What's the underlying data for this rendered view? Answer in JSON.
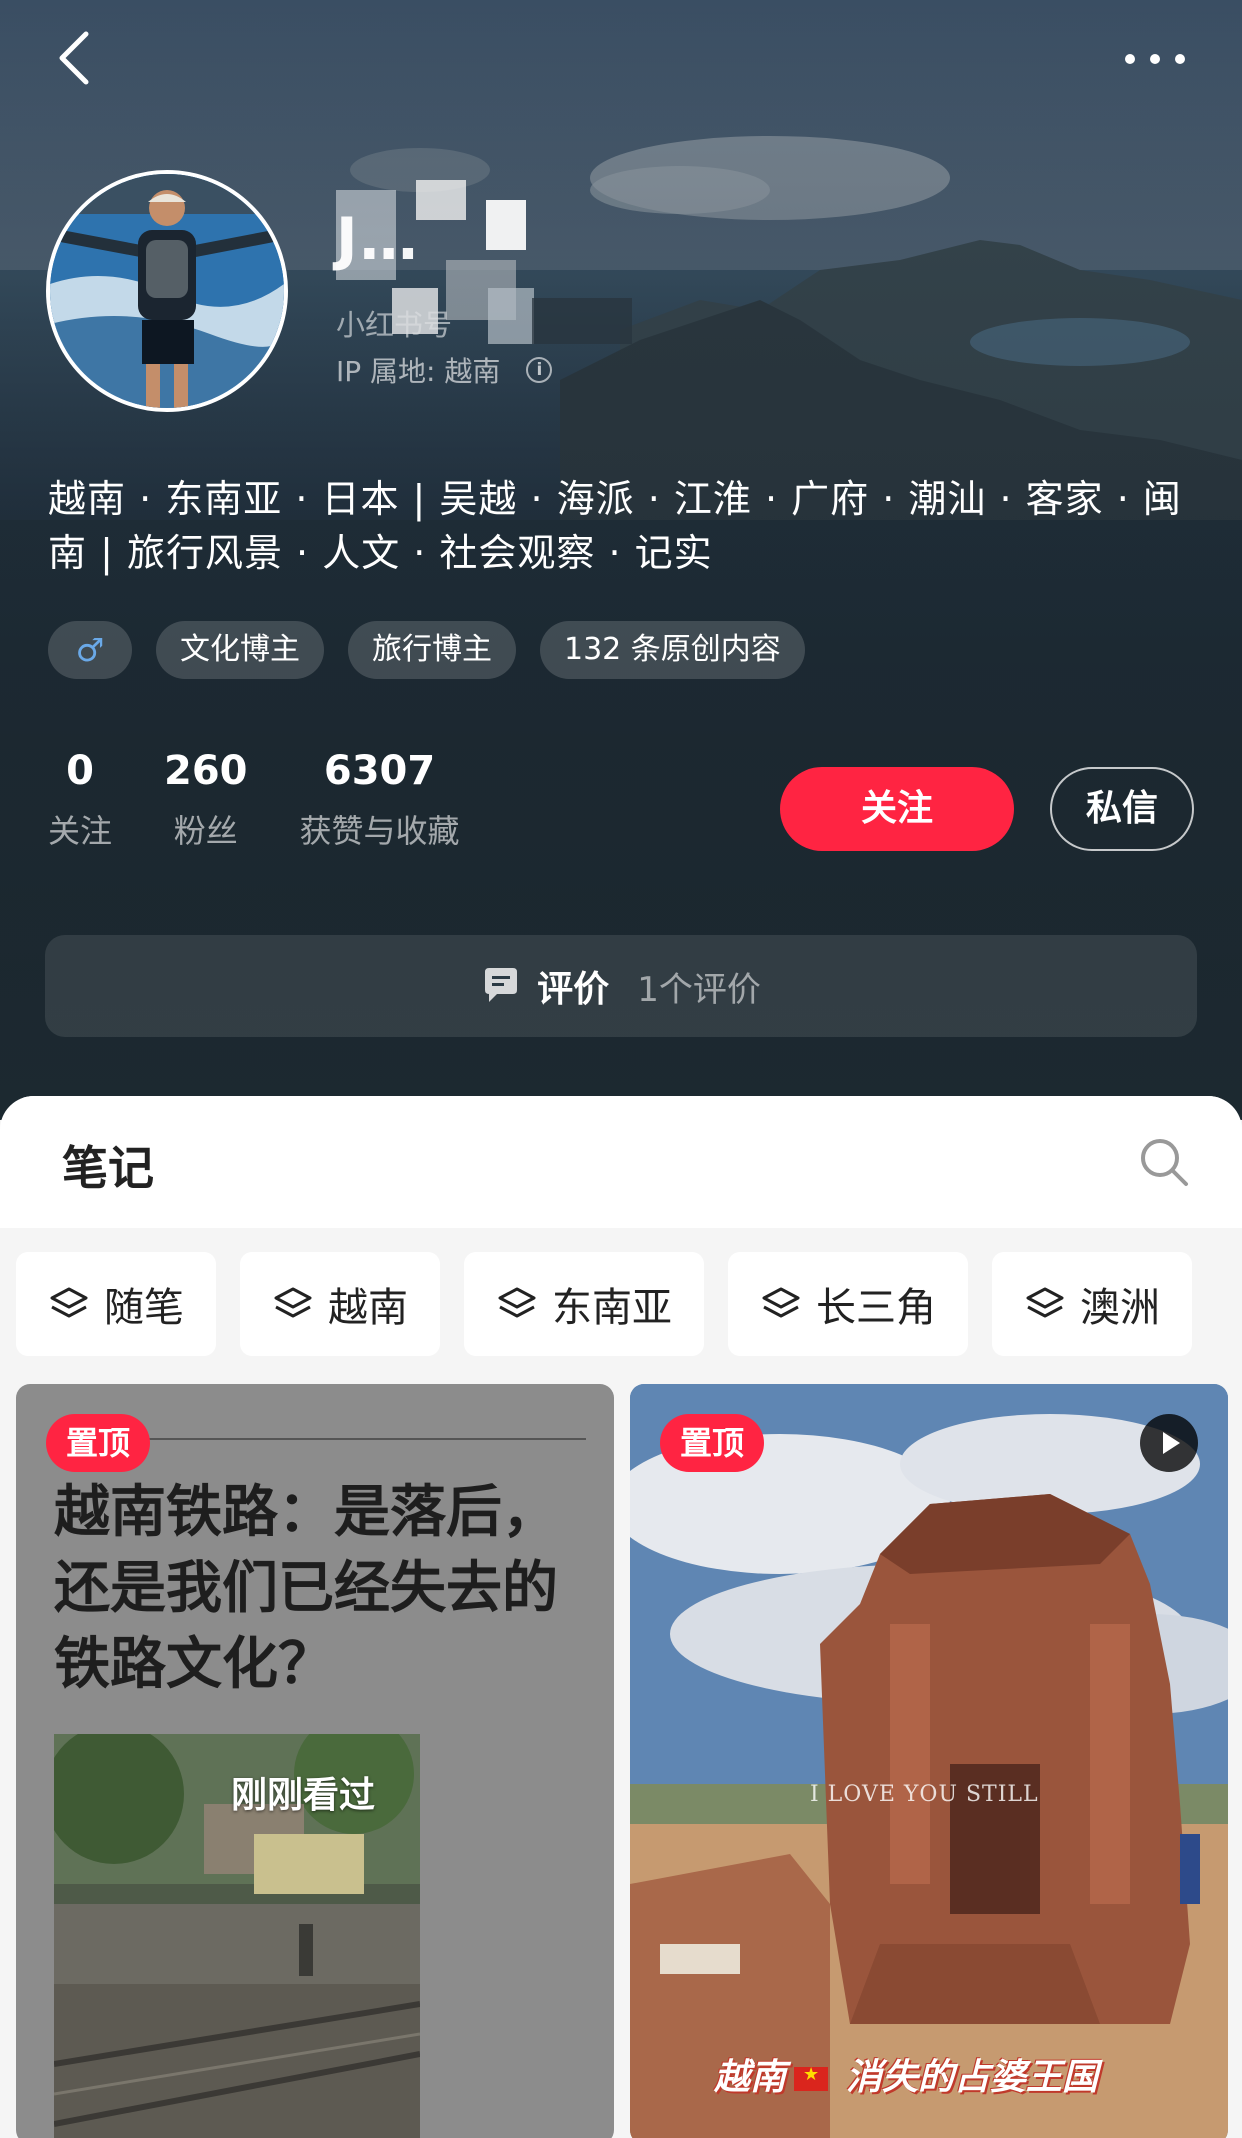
{
  "profile": {
    "name": "J…",
    "red_id_prefix": "小红书号",
    "ip_label": "IP 属地: 越南",
    "bio": "越南 · 东南亚 · 日本 | 吴越 · 海派 · 江淮 · 广府 · 潮汕 · 客家 · 闽南 | 旅行风景 · 人文 · 社会观察 · 记实",
    "gender_symbol": "♂",
    "tags": [
      "文化博主",
      "旅行博主",
      "132 条原创内容"
    ],
    "stats": [
      {
        "value": "0",
        "label": "关注"
      },
      {
        "value": "260",
        "label": "粉丝"
      },
      {
        "value": "6307",
        "label": "获赞与收藏"
      }
    ],
    "follow_label": "关注",
    "message_label": "私信"
  },
  "review": {
    "title": "评价",
    "count": "1个评价"
  },
  "notes": {
    "title": "笔记",
    "categories": [
      "随笔",
      "越南",
      "东南亚",
      "长三角",
      "澳洲"
    ]
  },
  "cards": [
    {
      "pin": "置顶",
      "title": "越南铁路：是落后，还是我们已经失去的铁路文化？",
      "seen": "刚刚看过"
    },
    {
      "pin": "置顶",
      "overlay_text": "I LOVE YOU STILL",
      "caption_a": "越南",
      "caption_b": "消失的占婆王国"
    }
  ],
  "colors": {
    "accent": "#ff2442",
    "hero_bg": "#1f2c35"
  },
  "icons": [
    "back-icon",
    "more-icon",
    "info-icon",
    "comment-icon",
    "search-icon",
    "layers-icon",
    "play-icon"
  ]
}
